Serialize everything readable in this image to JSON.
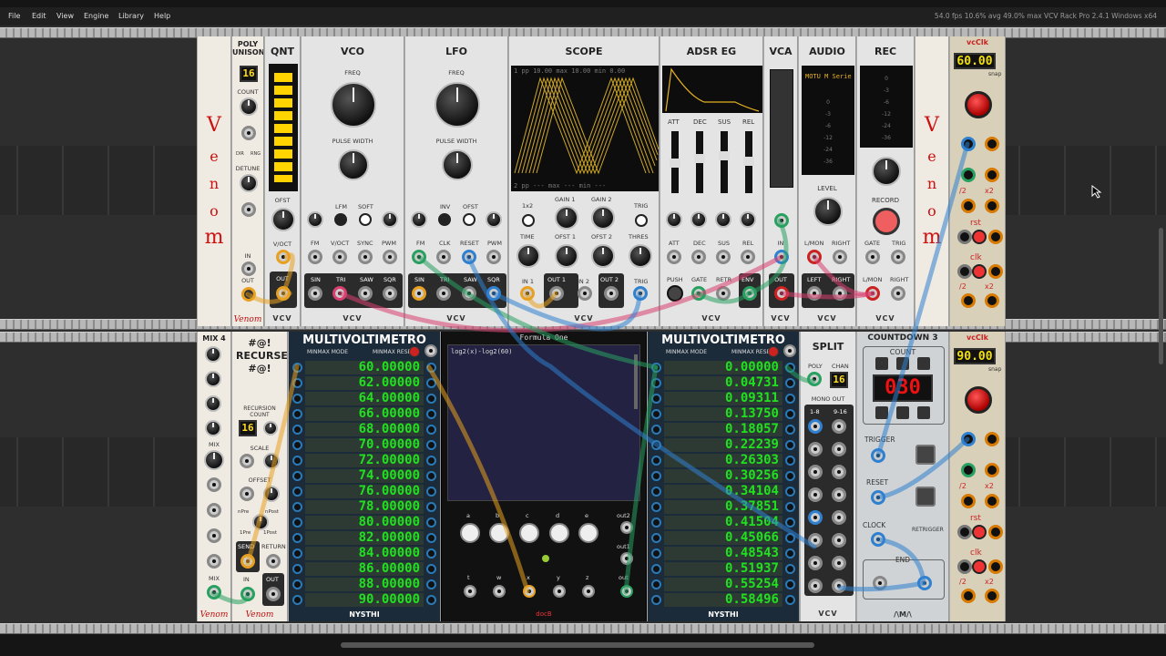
{
  "menu": {
    "file": "File",
    "edit": "Edit",
    "view": "View",
    "engine": "Engine",
    "library": "Library",
    "help": "Help"
  },
  "status": {
    "text": "54.0 fps  10.6% avg  49.0% max    VCV Rack Pro 2.4.1 Windows x64"
  },
  "modules": {
    "poly_unison": {
      "title": "POLY UNISON",
      "count_label": "COUNT",
      "detune_label": "DETUNE",
      "in_label": "IN",
      "out_label": "OUT",
      "display": "16",
      "dir": "DIR",
      "rng": "RNG",
      "brand": "Venom"
    },
    "qnt": {
      "title": "QNT",
      "ofst": "OFST",
      "voct": "V/OCT",
      "out": "OUT"
    },
    "vco": {
      "title": "VCO",
      "freq": "FREQ",
      "pulse_width": "PULSE WIDTH",
      "lfm": "LFM",
      "soft": "SOFT",
      "fm": "FM",
      "voct": "V/OCT",
      "sync": "SYNC",
      "pwm": "PWM",
      "sin": "SIN",
      "tri": "TRI",
      "saw": "SAW",
      "sqr": "SQR",
      "brand": "VCV"
    },
    "lfo": {
      "title": "LFO",
      "freq": "FREQ",
      "pulse_width": "PULSE WIDTH",
      "inv": "INV",
      "ofst": "OFST",
      "fm": "FM",
      "clk": "CLK",
      "reset": "RESET",
      "pwm": "PWM",
      "sin": "SIN",
      "tri": "TRI",
      "saw": "SAW",
      "sqr": "SQR",
      "brand": "VCV"
    },
    "scope": {
      "title": "SCOPE",
      "top_readout": "1  pp  10.00 max 10.00 min  0.00",
      "bottom_readout": "2  pp  ---  max  ---  min  ---",
      "x2": "1x2",
      "gain1": "GAIN 1",
      "gain2": "GAIN 2",
      "trig": "TRIG",
      "time": "TIME",
      "ofst1": "OFST 1",
      "ofst2": "OFST 2",
      "thres": "THRES",
      "in1": "IN 1",
      "out1": "OUT 1",
      "in2": "IN 2",
      "out2": "OUT 2",
      "trig_out": "TRIG",
      "brand": "VCV"
    },
    "adsr": {
      "title": "ADSR EG",
      "att": "ATT",
      "dec": "DEC",
      "sus": "SUS",
      "rel": "REL",
      "push": "PUSH",
      "gate": "GATE",
      "retr": "RETR",
      "env": "ENV",
      "brand": "VCV"
    },
    "vca": {
      "title": "VCA",
      "in": "IN",
      "out": "OUT",
      "brand": "VCV"
    },
    "audio": {
      "title": "AUDIO",
      "device": "MOTU M Serie",
      "meters": [
        "0",
        "-3",
        "-6",
        "-12",
        "-24",
        "-36"
      ],
      "level": "LEVEL",
      "lmon": "L/MON",
      "right": "RIGHT",
      "left": "LEFT",
      "brand": "VCV"
    },
    "rec": {
      "title": "REC",
      "meters": [
        "0",
        "-3",
        "-6",
        "-12",
        "-24",
        "-36"
      ],
      "record": "RECORD",
      "gate": "GATE",
      "trig": "TRIG",
      "lmon": "L/MON",
      "right": "RIGHT",
      "brand": "VCV"
    },
    "venom_logo": {
      "letters": [
        "V",
        "e",
        "n",
        "o",
        "m"
      ]
    },
    "vcclk1": {
      "title": "vcClk",
      "display": "60.00",
      "snap": "snap",
      "x2": "x2",
      "div2": "/2",
      "rst": "rst",
      "clk": "clk"
    },
    "vcclk2": {
      "title": "vcClk",
      "display": "90.00",
      "snap": "snap",
      "x2": "x2",
      "div2": "/2",
      "rst": "rst",
      "clk": "clk"
    },
    "mix4": {
      "title": "MIX 4",
      "mix": "MIX",
      "brand": "Venom"
    },
    "recurse": {
      "title": "#@! RECURSE #@!",
      "rec_count": "RECURSION COUNT",
      "display": "16",
      "scale": "SCALE",
      "offset": "OFFSET",
      "npre": "nPre",
      "npost": "nPost",
      "onepre": "1Pre",
      "onepost": "1Post",
      "send": "SEND",
      "return": "RETURN",
      "in": "IN",
      "out": "OUT",
      "brand": "Venom"
    },
    "mvm1": {
      "title": "MULTIVOLTIMETRO",
      "minmax_mode": "MINMAX MODE",
      "minmax_reset": "MINMAX RESET",
      "values": [
        "60.00000",
        "62.00000",
        "64.00000",
        "66.00000",
        "68.00000",
        "70.00000",
        "72.00000",
        "74.00000",
        "76.00000",
        "78.00000",
        "80.00000",
        "82.00000",
        "84.00000",
        "86.00000",
        "88.00000",
        "90.00000"
      ],
      "brand": "NYSTHI"
    },
    "formula": {
      "title": "Formula One",
      "expression": "log2(x)-log2(60)",
      "knobs": [
        "a",
        "b",
        "c",
        "d",
        "e"
      ],
      "vars": [
        "t",
        "w",
        "x",
        "y",
        "z"
      ],
      "out1": "out1",
      "out2": "out2",
      "out": "out",
      "brand": "docB"
    },
    "mvm2": {
      "title": "MULTIVOLTIMETRO",
      "minmax_mode": "MINMAX MODE",
      "minmax_reset": "MINMAX RESET",
      "values": [
        "0.00000",
        "0.04731",
        "0.09311",
        "0.13750",
        "0.18057",
        "0.22239",
        "0.26303",
        "0.30256",
        "0.34104",
        "0.37851",
        "0.41504",
        "0.45066",
        "0.48543",
        "0.51937",
        "0.55254",
        "0.58496"
      ],
      "brand": "NYSTHI"
    },
    "split": {
      "title": "SPLIT",
      "poly": "POLY",
      "chan": "CHAN",
      "display": "16",
      "mono_out": "MONO OUT",
      "range1": "1-8",
      "range2": "9-16",
      "brand": "VCV"
    },
    "countdown": {
      "title": "COUNTDOWN 3",
      "count": "COUNT",
      "display": "030",
      "trigger": "TRIGGER",
      "reset": "RESET",
      "clock": "CLOCK",
      "retrigger": "RETRIGGER",
      "end": "END",
      "brand": "/\\M/\\"
    }
  }
}
